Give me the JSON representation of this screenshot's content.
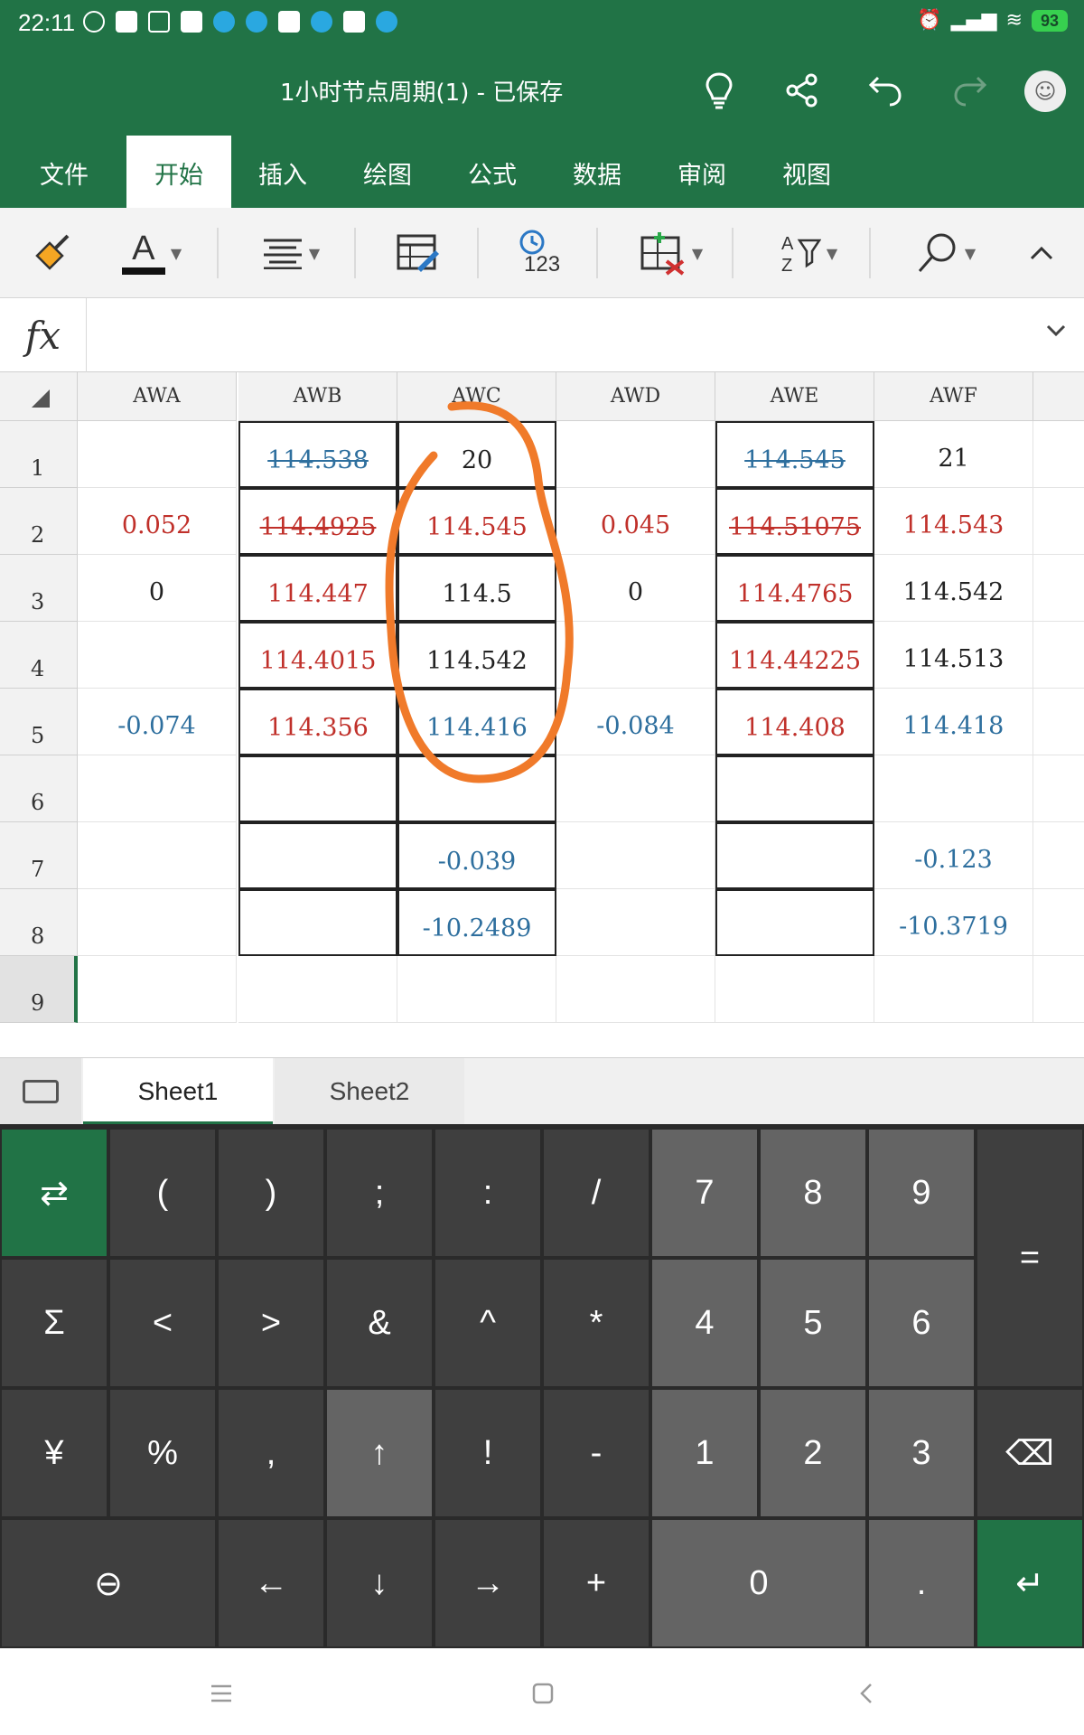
{
  "status_bar": {
    "time": "22:11",
    "battery": "93"
  },
  "title_bar": {
    "document_title": "1小时节点周期(1) - 已保存"
  },
  "ribbon": {
    "tabs": [
      "文件",
      "开始",
      "插入",
      "绘图",
      "公式",
      "数据",
      "审阅",
      "视图"
    ],
    "active_tab": "开始"
  },
  "toolbar": {
    "font_color_letter": "A",
    "number_format_label": "123"
  },
  "formula_bar": {
    "fx_label": "fx",
    "value": ""
  },
  "grid": {
    "columns": [
      "AWA",
      "AWB",
      "AWC",
      "AWD",
      "AWE",
      "AWF"
    ],
    "rows": [
      "1",
      "2",
      "3",
      "4",
      "5",
      "6",
      "7",
      "8",
      "9"
    ],
    "selected_row": "9",
    "cells": {
      "AWA": [
        "",
        "0.052",
        "0",
        "",
        "-0.074",
        "",
        "",
        "",
        ""
      ],
      "AWB": [
        "114.538",
        "114.4925",
        "114.447",
        "114.4015",
        "114.356",
        "",
        "",
        "",
        ""
      ],
      "AWC": [
        "20",
        "114.545",
        "114.5",
        "114.542",
        "114.416",
        "",
        "-0.039",
        "-10.2489",
        ""
      ],
      "AWD": [
        "",
        "0.045",
        "0",
        "",
        "-0.084",
        "",
        "",
        "",
        ""
      ],
      "AWE": [
        "114.545",
        "114.51075",
        "114.4765",
        "114.44225",
        "114.408",
        "",
        "",
        "",
        ""
      ],
      "AWF": [
        "21",
        "114.543",
        "114.542",
        "114.513",
        "114.418",
        "",
        "-0.123",
        "-10.3719",
        ""
      ]
    },
    "colors": {
      "black": "#222222",
      "red": "#c0302a",
      "blue": "#2e6f9e",
      "annotation": "#f07a2a"
    }
  },
  "sheets": {
    "tabs": [
      "Sheet1",
      "Sheet2"
    ],
    "active": "Sheet1"
  },
  "keypad": {
    "row1": [
      "⇄",
      "(",
      ")",
      ";",
      ":",
      "/",
      "7",
      "8",
      "9",
      "="
    ],
    "row2": [
      "Σ",
      "<",
      ">",
      "&",
      "^",
      "*",
      "4",
      "5",
      "6"
    ],
    "row3": [
      "¥",
      "%",
      ",",
      "↑",
      "!",
      "-",
      "1",
      "2",
      "3",
      "⌫"
    ],
    "row4": [
      "⊖",
      "←",
      "↓",
      "→",
      "+",
      "0",
      ".",
      "↵"
    ]
  },
  "theme": {
    "accent": "#217346",
    "key_dark": "#3f3f3f",
    "key_num": "#646464"
  }
}
